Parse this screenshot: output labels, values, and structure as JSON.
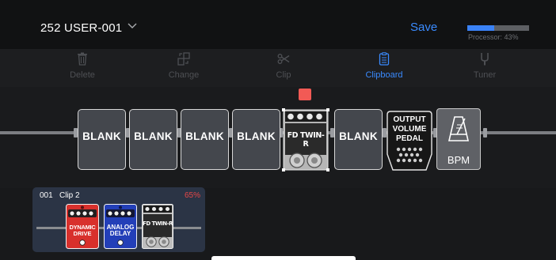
{
  "header": {
    "preset_name": "252 USER-001",
    "save_label": "Save",
    "processor_label": "Processor: 43%",
    "processor_fraction": 0.43,
    "accent": "#3a8bff"
  },
  "toolbar": {
    "items": [
      {
        "label": "Delete",
        "icon": "trash-icon"
      },
      {
        "label": "Change",
        "icon": "swap-icon"
      },
      {
        "label": "Clip",
        "icon": "scissors-icon"
      },
      {
        "label": "Clipboard",
        "icon": "clipboard-icon",
        "active": true
      },
      {
        "label": "Tuner",
        "icon": "tuning-fork-icon"
      }
    ]
  },
  "chain": {
    "slots": [
      {
        "label": "BLANK"
      },
      {
        "label": "BLANK"
      },
      {
        "label": "BLANK"
      },
      {
        "label": "BLANK"
      },
      {
        "label": "FD TWIN-R",
        "type": "amp",
        "selected": true
      },
      {
        "label": "BLANK"
      },
      {
        "label": "OUTPUT VOLUME PEDAL",
        "line1": "OUTPUT",
        "line2": "VOLUME",
        "line3": "PEDAL"
      },
      {
        "label": "BPM"
      }
    ]
  },
  "clip": {
    "number": "001",
    "name": "Clip 2",
    "percent": "65%",
    "percent_color": "#e84747",
    "effects": [
      {
        "line1": "DYNAMIC",
        "line2": "DRIVE",
        "color": "#d8302c"
      },
      {
        "line1": "ANALOG",
        "line2": "DELAY",
        "color": "#233fb8"
      },
      {
        "line1": "FD TWIN-R",
        "color": "#bdbdbd"
      }
    ]
  }
}
